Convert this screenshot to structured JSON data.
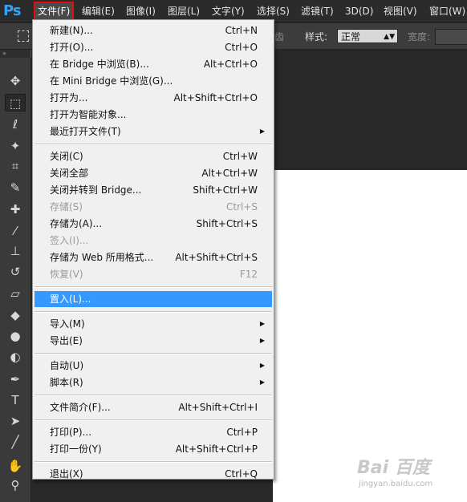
{
  "app": {
    "logo": "Ps"
  },
  "menubar": {
    "items": [
      {
        "label": "文件(F)",
        "active": true
      },
      {
        "label": "编辑(E)"
      },
      {
        "label": "图像(I)"
      },
      {
        "label": "图层(L)"
      },
      {
        "label": "文字(Y)"
      },
      {
        "label": "选择(S)"
      },
      {
        "label": "滤镜(T)"
      },
      {
        "label": "3D(D)"
      },
      {
        "label": "视图(V)"
      },
      {
        "label": "窗口(W)"
      }
    ],
    "accent": "#e01010"
  },
  "options": {
    "partial_label": "齿",
    "style_label": "样式:",
    "style_value": "正常",
    "width_label": "宽度:"
  },
  "toolbar": {
    "head": "»",
    "tools": [
      "move-icon",
      "marquee-icon",
      "lasso-icon",
      "magic-wand-icon",
      "crop-icon",
      "eyedropper-icon",
      "healing-icon",
      "brush-icon",
      "stamp-icon",
      "history-brush-icon",
      "eraser-icon",
      "paint-bucket-icon",
      "blur-icon",
      "dodge-icon",
      "pen-icon",
      "type-icon",
      "path-select-icon",
      "line-icon",
      "hand-icon",
      "zoom-icon"
    ]
  },
  "file_menu": {
    "items": [
      {
        "label": "新建(N)...",
        "shortcut": "Ctrl+N"
      },
      {
        "label": "打开(O)...",
        "shortcut": "Ctrl+O"
      },
      {
        "label": "在 Bridge 中浏览(B)...",
        "shortcut": "Alt+Ctrl+O"
      },
      {
        "label": "在 Mini Bridge 中浏览(G)...",
        "shortcut": ""
      },
      {
        "label": "打开为...",
        "shortcut": "Alt+Shift+Ctrl+O"
      },
      {
        "label": "打开为智能对象...",
        "shortcut": ""
      },
      {
        "label": "最近打开文件(T)",
        "shortcut": "",
        "submenu": true
      },
      {
        "sep": true
      },
      {
        "label": "关闭(C)",
        "shortcut": "Ctrl+W"
      },
      {
        "label": "关闭全部",
        "shortcut": "Alt+Ctrl+W"
      },
      {
        "label": "关闭并转到 Bridge...",
        "shortcut": "Shift+Ctrl+W"
      },
      {
        "label": "存储(S)",
        "shortcut": "Ctrl+S",
        "disabled": true
      },
      {
        "label": "存储为(A)...",
        "shortcut": "Shift+Ctrl+S"
      },
      {
        "label": "签入(I)...",
        "shortcut": "",
        "disabled": true
      },
      {
        "label": "存储为 Web 所用格式...",
        "shortcut": "Alt+Shift+Ctrl+S"
      },
      {
        "label": "恢复(V)",
        "shortcut": "F12",
        "disabled": true
      },
      {
        "sep": true
      },
      {
        "label": "置入(L)...",
        "shortcut": "",
        "highlighted": true
      },
      {
        "sep": true
      },
      {
        "label": "导入(M)",
        "shortcut": "",
        "submenu": true
      },
      {
        "label": "导出(E)",
        "shortcut": "",
        "submenu": true
      },
      {
        "sep": true
      },
      {
        "label": "自动(U)",
        "shortcut": "",
        "submenu": true
      },
      {
        "label": "脚本(R)",
        "shortcut": "",
        "submenu": true
      },
      {
        "sep": true
      },
      {
        "label": "文件简介(F)...",
        "shortcut": "Alt+Shift+Ctrl+I"
      },
      {
        "sep": true
      },
      {
        "label": "打印(P)...",
        "shortcut": "Ctrl+P"
      },
      {
        "label": "打印一份(Y)",
        "shortcut": "Alt+Shift+Ctrl+P"
      },
      {
        "sep": true
      },
      {
        "label": "退出(X)",
        "shortcut": "Ctrl+Q"
      }
    ],
    "highlight_color": "#3399ff"
  },
  "watermark": {
    "text": "Bai 百度",
    "sub": "jingyan.baidu.com"
  }
}
